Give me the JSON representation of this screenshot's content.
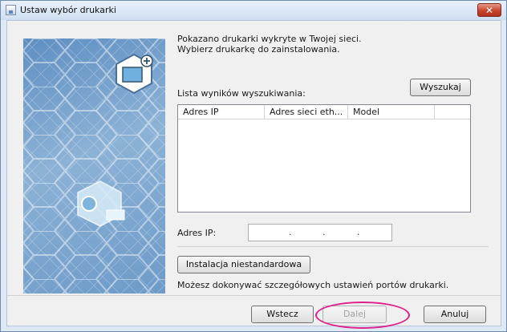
{
  "window": {
    "title": "Ustaw wybór drukarki",
    "close_label": "✕"
  },
  "intro": {
    "line1": "Pokazano drukarki wykryte w Twojej sieci.",
    "line2": "Wybierz drukarkę do zainstalowania."
  },
  "search": {
    "results_label": "Lista wyników wyszukiwania:",
    "button_label": "Wyszukaj"
  },
  "results_table": {
    "columns": [
      "Adres IP",
      "Adres sieci eth...",
      "Model"
    ],
    "rows": []
  },
  "ip_address": {
    "label": "Adres IP:",
    "separators": [
      ".",
      ".",
      "."
    ],
    "value": ""
  },
  "custom_install": {
    "button_label": "Instalacja niestandardowa",
    "description": "Możesz dokonywać szczegółowych ustawień portów drukarki."
  },
  "footer": {
    "back_label": "Wstecz",
    "next_label": "Dalej",
    "cancel_label": "Anuluj"
  },
  "colors": {
    "banner_blue": "#6d9ac8",
    "highlight_ring": "#e0208a",
    "close_button": "#c8452d"
  }
}
